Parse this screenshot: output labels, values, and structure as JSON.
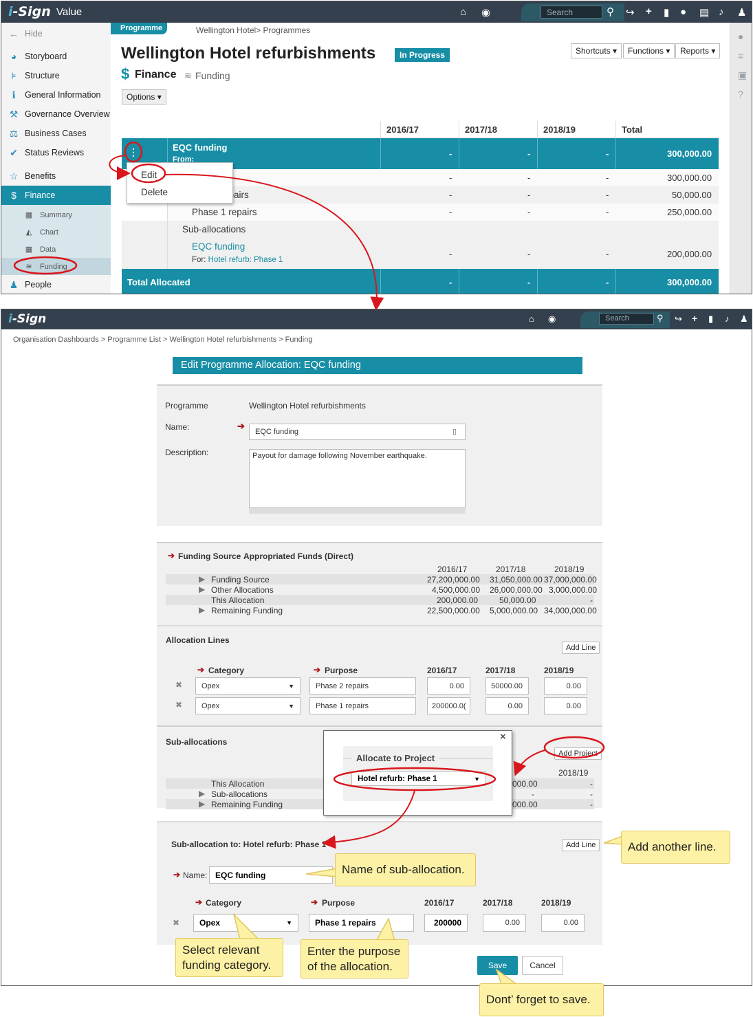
{
  "shot1": {
    "app": {
      "logo_i": "i",
      "logo_rest": "-Sign",
      "title": "Value",
      "search_placeholder": "Search"
    },
    "sidebar": {
      "hide": "Hide",
      "items": [
        "Storyboard",
        "Structure",
        "General Information",
        "Governance Overview",
        "Business Cases",
        "Status Reviews",
        "Benefits",
        "Finance"
      ],
      "subitems": [
        "Summary",
        "Chart",
        "Data",
        "Funding"
      ],
      "last": "People"
    },
    "tag": "Programme",
    "breadcrumb": "Wellington Hotel> Programmes",
    "title": "Wellington Hotel refurbishments",
    "status": "In Progress",
    "section": "Finance",
    "subsection": "Funding",
    "options": "Options",
    "buttons": {
      "shortcuts": "Shortcuts",
      "functions": "Functions",
      "reports": "Reports"
    },
    "table": {
      "headers": [
        "2016/17",
        "2017/18",
        "2018/19",
        "Total"
      ],
      "group_title": "EQC funding",
      "group_from": "From:",
      "group_values": [
        "-",
        "-",
        "-",
        "300,000.00"
      ],
      "rows": [
        {
          "label": "",
          "values": [
            "-",
            "-",
            "-",
            "300,000.00"
          ]
        },
        {
          "label": "epairs",
          "values": [
            "-",
            "-",
            "-",
            "50,000.00"
          ]
        },
        {
          "label": "Phase 1 repairs",
          "values": [
            "-",
            "-",
            "-",
            "250,000.00"
          ]
        }
      ],
      "suballoc_label": "Sub-allocations",
      "suballoc_link": "EQC funding",
      "suballoc_for_prefix": "For:",
      "suballoc_for_link": "Hotel refurb: Phase 1",
      "suballoc_values": [
        "-",
        "-",
        "-",
        "200,000.00"
      ],
      "total_label": "Total Allocated",
      "total_values": [
        "-",
        "-",
        "-",
        "300,000.00"
      ]
    },
    "menu": {
      "edit": "Edit",
      "delete": "Delete"
    }
  },
  "shot2": {
    "search_placeholder": "Search",
    "breadcrumb": "Organisation Dashboards > Programme List > Wellington Hotel refurbishments > Funding",
    "dialog_title": "Edit Programme Allocation: EQC funding",
    "programme_label": "Programme",
    "programme_value": "Wellington Hotel refurbishments",
    "name_label": "Name:",
    "name_value": "EQC funding",
    "desc_label": "Description:",
    "desc_value": "Payout for damage following November earthquake.",
    "fs_label": "Funding Source",
    "fs_value": "Appropriated Funds (Direct)",
    "years": [
      "2016/17",
      "2017/18",
      "2018/19"
    ],
    "fs_rows": [
      {
        "label": "Funding Source",
        "values": [
          "27,200,000.00",
          "31,050,000.00",
          "37,000,000.00"
        ]
      },
      {
        "label": "Other Allocations",
        "values": [
          "4,500,000.00",
          "26,000,000.00",
          "3,000,000.00"
        ]
      },
      {
        "label": "This Allocation",
        "values": [
          "200,000.00",
          "50,000.00",
          "-"
        ]
      },
      {
        "label": "Remaining Funding",
        "values": [
          "22,500,000.00",
          "5,000,000.00",
          "34,000,000.00"
        ]
      }
    ],
    "alloc_lines_title": "Allocation Lines",
    "add_line": "Add Line",
    "col_category": "Category",
    "col_purpose": "Purpose",
    "alloc_lines": [
      {
        "category": "Opex",
        "purpose": "Phase 2 repairs",
        "values": [
          "0.00",
          "50000.00",
          "0.00"
        ]
      },
      {
        "category": "Opex",
        "purpose": "Phase 1 repairs",
        "values": [
          "200000.0(",
          "0.00",
          "0.00"
        ]
      }
    ],
    "sub_title": "Sub-allocations",
    "add_project": "Add Project",
    "sub_year": "2018/19",
    "sub_rows": [
      {
        "label": "This Allocation",
        "partial": "000.00",
        "value": "-"
      },
      {
        "label": "Sub-allocations",
        "partial": "-",
        "value": "-"
      },
      {
        "label": "Remaining Funding",
        "partial": "000.00",
        "value": "-"
      }
    ],
    "popup": {
      "title": "Allocate to Project",
      "selected": "Hotel refurb: Phase 1",
      "close": "×"
    },
    "suballoc_to": "Sub-allocation to: Hotel refurb: Phase 1",
    "sub_name_label": "Name:",
    "sub_name_value": "EQC funding",
    "sub_line": {
      "category": "Opex",
      "purpose": "Phase 1 repairs",
      "values": [
        "200000",
        "0.00",
        "0.00"
      ]
    },
    "save": "Save",
    "cancel": "Cancel"
  },
  "callouts": {
    "add_line": "Add another line.",
    "name": "Name of sub-allocation.",
    "category": "Select relevant funding category.",
    "purpose": "Enter the purpose of the allocation.",
    "save": "Dont’ forget to save."
  },
  "colors": {
    "accent": "#178ea6",
    "header": "#34404e",
    "highlight": "#d9161c",
    "callout": "#fdf1a5"
  }
}
